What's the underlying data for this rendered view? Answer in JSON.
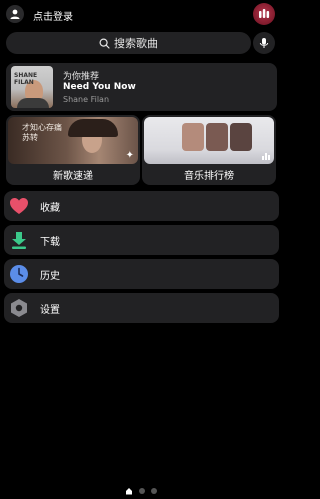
{
  "header": {
    "login_label": "点击登录"
  },
  "search": {
    "label": "搜索歌曲"
  },
  "recommend": {
    "title": "为你推荐",
    "song": "Need You Now",
    "artist": "Shane Filan",
    "cover_text": "SHANE FILAN"
  },
  "tiles": [
    {
      "label": "新歌速递",
      "overlay": "才知心存痛\n苏转"
    },
    {
      "label": "音乐排行榜"
    }
  ],
  "menu": [
    {
      "label": "收藏",
      "icon": "heart-icon",
      "color": "#e8506a"
    },
    {
      "label": "下载",
      "icon": "download-icon",
      "color": "#3bc98a"
    },
    {
      "label": "历史",
      "icon": "clock-icon",
      "color": "#5b8de8"
    },
    {
      "label": "设置",
      "icon": "gear-icon",
      "color": "#8a8a8f"
    }
  ],
  "pager": {
    "pages": 3,
    "current": 1
  },
  "colors": {
    "background": "#000000",
    "card": "#222224",
    "secondary_text": "#9b9b9b"
  }
}
